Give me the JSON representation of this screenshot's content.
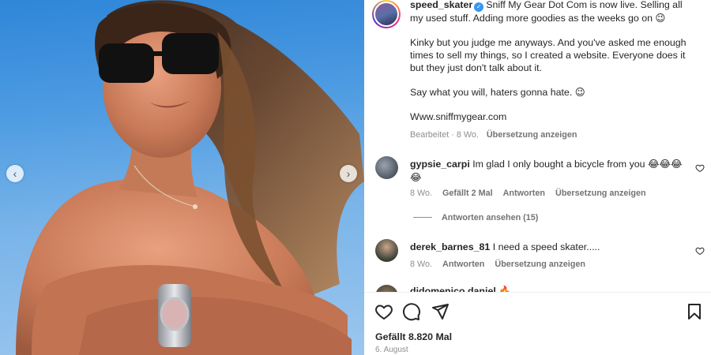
{
  "post": {
    "username": "speed_skater",
    "caption_line1": "Sniff My Gear Dot Com is now live. Selling all my used stuff. Adding more goodies as the weeks go on 😉",
    "caption_para2": "Kinky but you judge me anyways. And you've asked me enough times to sell my things, so I created a website. Everyone does it but they just don't talk about it.",
    "caption_para3": "Say what you will, haters gonna hate. 😉",
    "caption_link": "Www.sniffmygear.com",
    "meta_edited": "Bearbeitet · 8 Wo.",
    "meta_translate": "Übersetzung anzeigen"
  },
  "comments": [
    {
      "username": "gypsie_carpi",
      "text": "Im glad I only bought a bicycle from you 😂😂😂😂",
      "time": "8 Wo.",
      "likes": "Gefällt 2 Mal",
      "reply": "Antworten",
      "translate": "Übersetzung anzeigen",
      "view_replies": "Antworten ansehen (15)"
    },
    {
      "username": "derek_barnes_81",
      "text": "I need a speed skater.....",
      "time": "8 Wo.",
      "reply": "Antworten",
      "translate": "Übersetzung anzeigen"
    },
    {
      "username": "didomenico.daniel",
      "text": "🔥"
    }
  ],
  "footer": {
    "likes": "Gefällt 8.820 Mal",
    "date": "6. August"
  },
  "icons": {
    "like": "heart-icon",
    "comment": "comment-icon",
    "share": "send-icon",
    "save": "bookmark-icon",
    "prev": "chevron-left-icon",
    "next": "chevron-right-icon",
    "verified": "verified-badge-icon"
  },
  "colors": {
    "sky": "#4d9be2",
    "verified": "#3897f0",
    "muted": "#8e8e8e",
    "text": "#262626"
  }
}
